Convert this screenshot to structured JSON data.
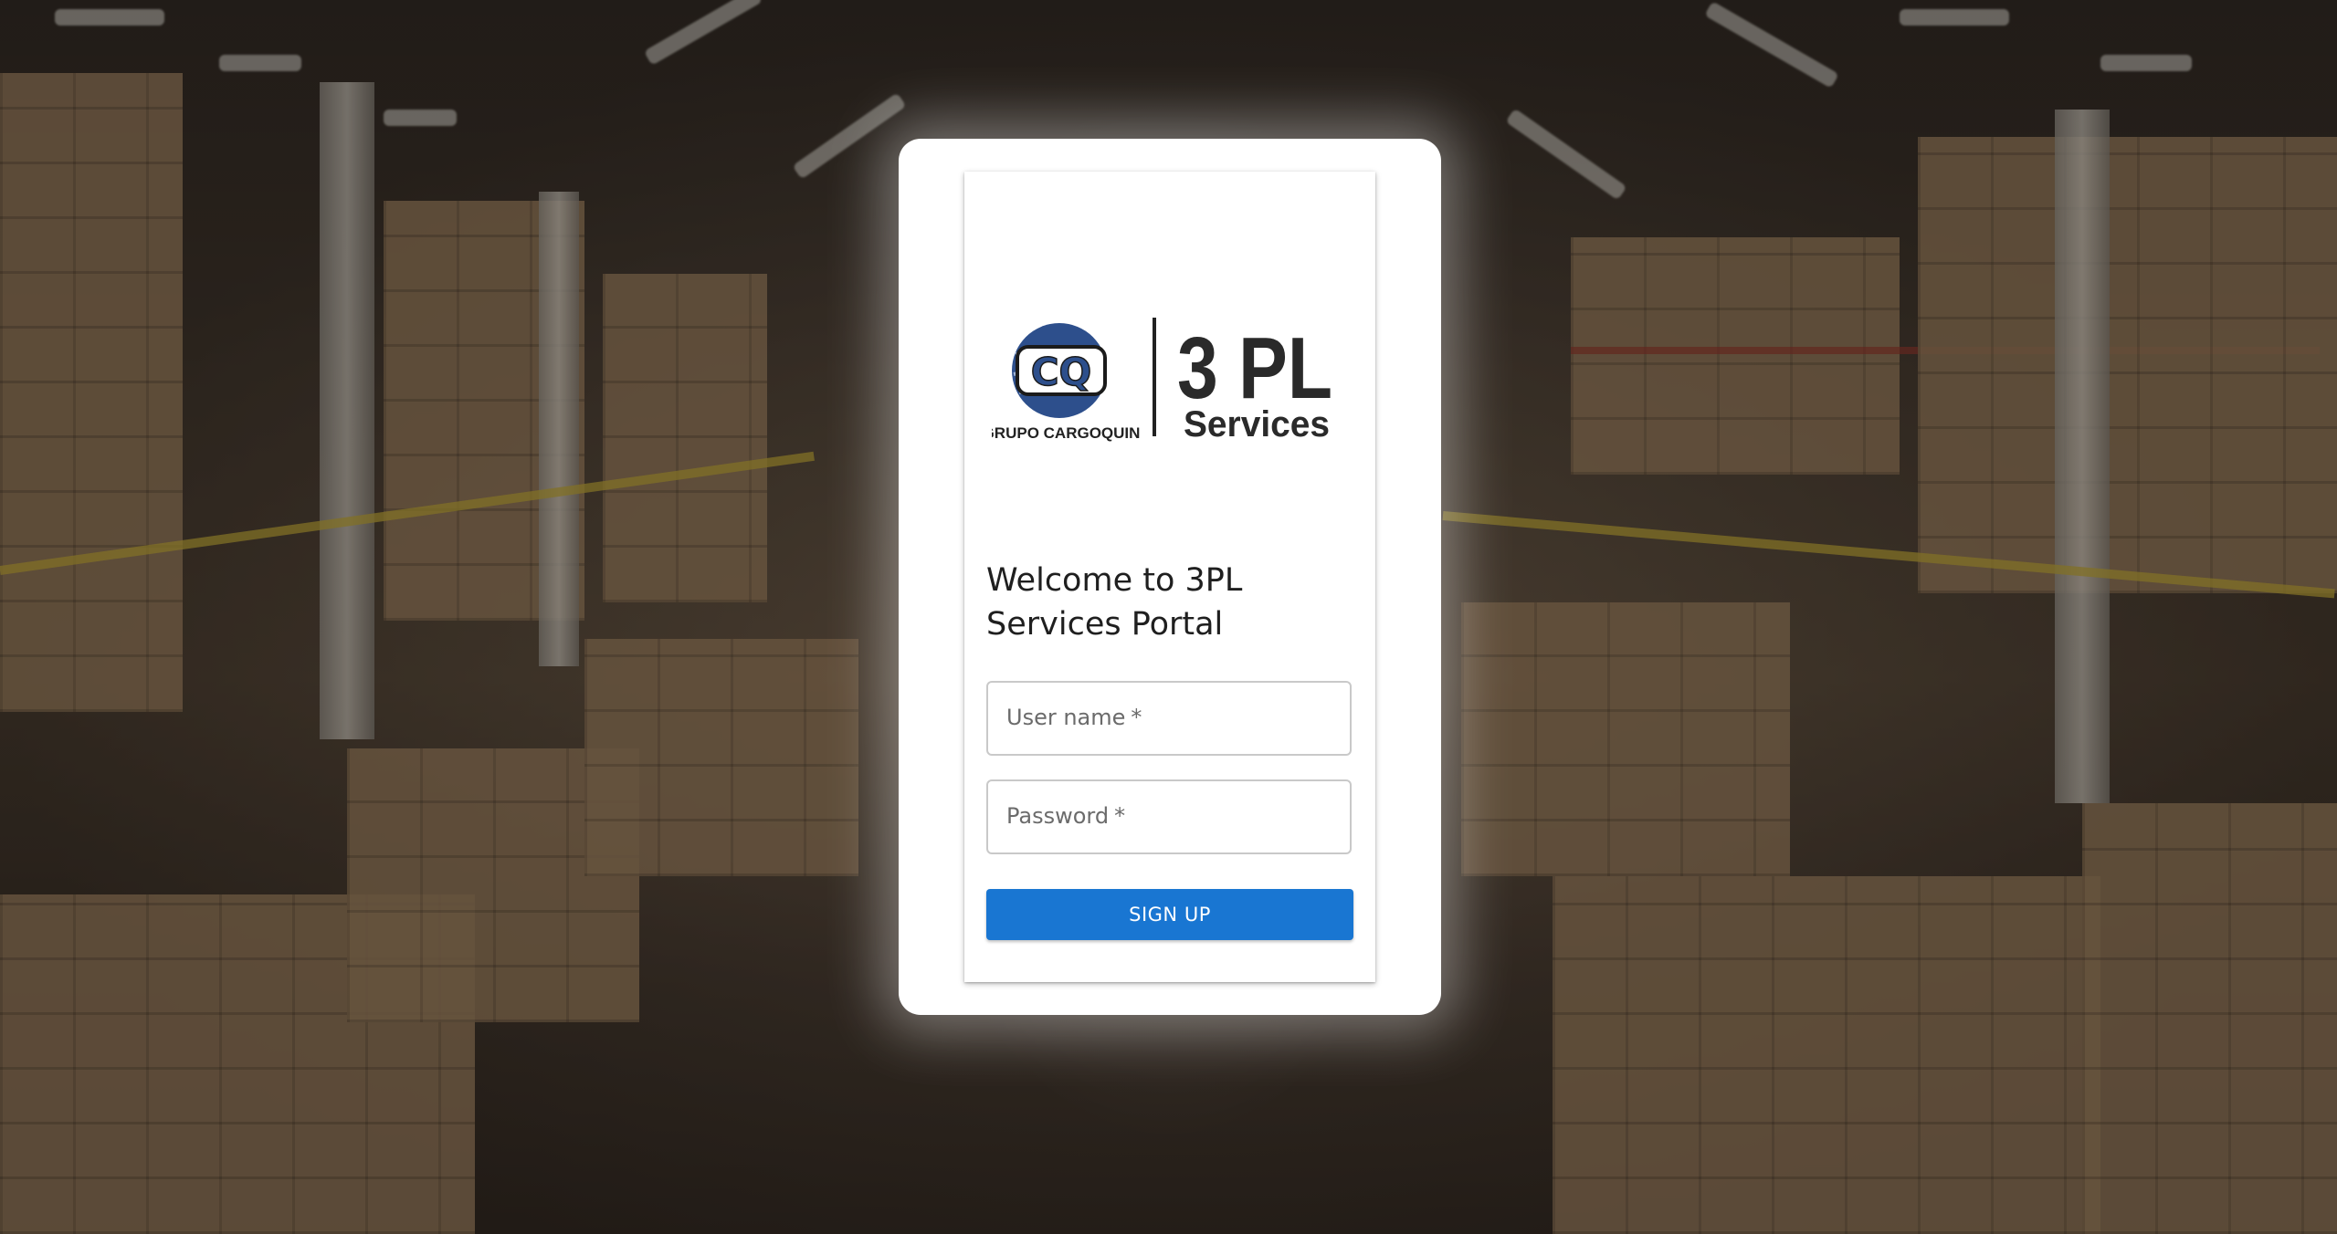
{
  "brand": {
    "company_name": "GRUPO CARGOQUIN",
    "emblem_letters": "CQ",
    "product_name_top": "3 PL",
    "product_name_bottom": "Services"
  },
  "login": {
    "heading": "Welcome to 3PL Services Portal",
    "username_label": "User name",
    "password_label": "Password",
    "required_marker": "*",
    "submit_label": "SIGN UP"
  },
  "colors": {
    "primary": "#1976d2",
    "card_background": "#ffffff",
    "heading_text": "#1f1f1f",
    "field_border": "#c9c9c9"
  },
  "background": {
    "description_icon": "warehouse-background"
  }
}
